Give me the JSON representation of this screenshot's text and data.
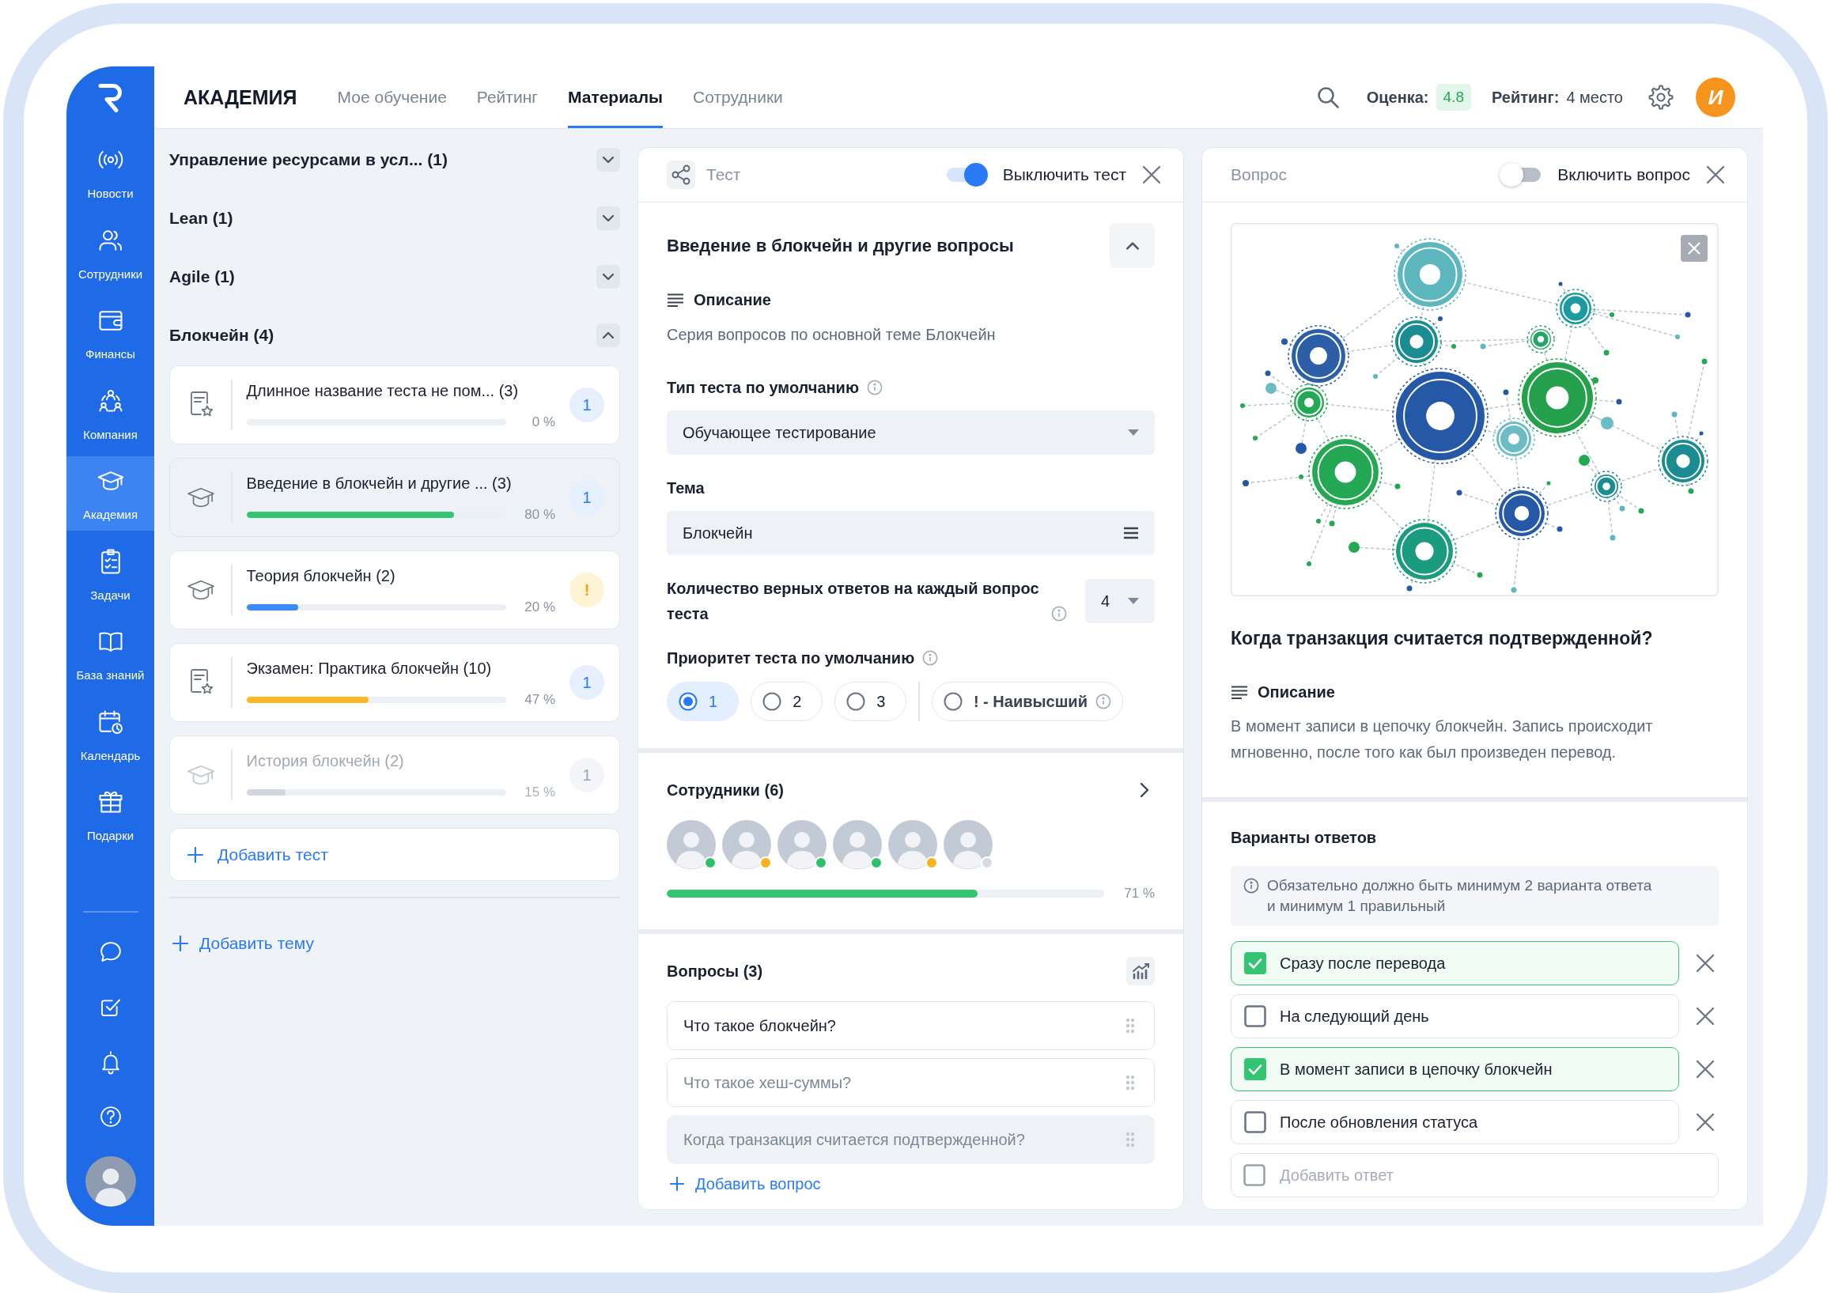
{
  "sidebar": {
    "items": [
      {
        "label": "Новости",
        "selected": false
      },
      {
        "label": "Сотрудники",
        "selected": false
      },
      {
        "label": "Финансы",
        "selected": false
      },
      {
        "label": "Компания",
        "selected": false
      },
      {
        "label": "Академия",
        "selected": true
      },
      {
        "label": "Задачи",
        "selected": false
      },
      {
        "label": "База знаний",
        "selected": false
      },
      {
        "label": "Календарь",
        "selected": false
      },
      {
        "label": "Подарки",
        "selected": false
      }
    ]
  },
  "header": {
    "title": "АКАДЕМИЯ",
    "tabs": [
      {
        "label": "Мое обучение",
        "selected": false
      },
      {
        "label": "Рейтинг",
        "selected": false
      },
      {
        "label": "Материалы",
        "selected": true
      },
      {
        "label": "Сотрудники",
        "selected": false
      }
    ],
    "score_label": "Оценка:",
    "score": "4.8",
    "rating_label": "Рейтинг:",
    "rating": "4 место",
    "avatar_initial": "И"
  },
  "topics": [
    {
      "title": "Управление ресурсами в усл... (1)",
      "expanded": false
    },
    {
      "title": "Lean (1)",
      "expanded": false
    },
    {
      "title": "Agile (1)",
      "expanded": false
    },
    {
      "title": "Блокчейн (4)",
      "expanded": true,
      "tests": [
        {
          "kind": "exam",
          "title": "Длинное название теста не пом... (3)",
          "progress_label": "0 %",
          "badge": {
            "kind": "count",
            "text": "1"
          },
          "selected": false,
          "disabled": false
        },
        {
          "kind": "course",
          "title": "Введение в блокчейн и другие ... (3)",
          "level": 0.8,
          "color": "#34c472",
          "progress_label": "80 %",
          "badge": {
            "kind": "count",
            "text": "1"
          },
          "selected": true,
          "disabled": false
        },
        {
          "kind": "course",
          "title": "Теория блокчейн (2)",
          "level": 0.2,
          "color": "#3d8bf7",
          "progress_label": "20 %",
          "badge": {
            "kind": "warning",
            "text": "!"
          },
          "selected": false,
          "disabled": false
        },
        {
          "kind": "exam",
          "title": "Экзамен: Практика блокчейн (10)",
          "level": 0.47,
          "color": "#fbb925",
          "progress_label": "47 %",
          "badge": {
            "kind": "count",
            "text": "1"
          },
          "selected": false,
          "disabled": false
        },
        {
          "kind": "course",
          "title": "История блокчейн (2)",
          "level": 0.15,
          "color": "#d3d7dd",
          "progress_label": "15 %",
          "badge": {
            "kind": "count",
            "text": "1"
          },
          "selected": false,
          "disabled": true
        }
      ]
    }
  ],
  "add_test": "Добавить тест",
  "add_topic": "Добавить тему",
  "test_panel": {
    "label": "Тест",
    "toggle": {
      "label": "Выключить тест",
      "on": true
    },
    "title": "Введение в блокчейн и другие вопросы",
    "expanded": true,
    "description": {
      "label": "Описание",
      "text": "Серия вопросов по основной теме Блокчейн"
    },
    "test_type": {
      "label": "Тип теста по умолчанию",
      "value": "Обучающее тестирование"
    },
    "topic": {
      "label": "Тема",
      "value": "Блокчейн"
    },
    "correct_answers": {
      "label": "Количество верных ответов на каждый вопрос теста",
      "value": "4"
    },
    "priority": {
      "label": "Приоритет теста по умолчанию",
      "options": [
        {
          "kind": "level",
          "label": "1",
          "selected": true
        },
        {
          "kind": "level",
          "label": "2",
          "selected": false
        },
        {
          "kind": "level",
          "label": "3",
          "selected": false
        },
        {
          "kind": "highest",
          "label": "! - Наивысший",
          "selected": false
        }
      ]
    },
    "employees": {
      "title": "Сотрудники (6)",
      "members": [
        {
          "color": "#2fc06b"
        },
        {
          "color": "#f9b21c"
        },
        {
          "color": "#2fc06b"
        },
        {
          "color": "#2fc06b"
        },
        {
          "color": "#f9b21c"
        },
        {
          "color": "#d6dbe3"
        }
      ],
      "level": 0.71,
      "progress_label": "71 %"
    },
    "questions": {
      "title": "Вопросы (3)",
      "items": [
        {
          "text": "Что такое блокчейн?",
          "selected": false,
          "disabled": false
        },
        {
          "text": "Что такое хеш-суммы?",
          "selected": false,
          "disabled": true
        },
        {
          "text": "Когда транзакция считается подтвержденной?",
          "selected": true,
          "disabled": true
        }
      ],
      "add_label": "Добавить вопрос"
    }
  },
  "question_panel": {
    "label": "Вопрос",
    "toggle": {
      "label": "Включить вопрос",
      "on": false
    },
    "title": "Когда транзакция считается подтвержденной?",
    "description": {
      "label": "Описание",
      "text": "В момент записи в цепочку блокчейн. Запись происходит мгновенно, после того как был произведен перевод."
    },
    "answers": {
      "title": "Варианты ответов",
      "note": "Обязательно должно быть минимум 2 варианта ответа и минимум 1 правильный",
      "items": [
        {
          "text": "Сразу после перевода",
          "checked": true
        },
        {
          "text": "На следующий день",
          "checked": false
        },
        {
          "text": "В момент записи в цепочку блокчейн",
          "checked": true
        },
        {
          "text": "После обновления статуса",
          "checked": false
        }
      ],
      "add_placeholder": "Добавить ответ"
    }
  }
}
